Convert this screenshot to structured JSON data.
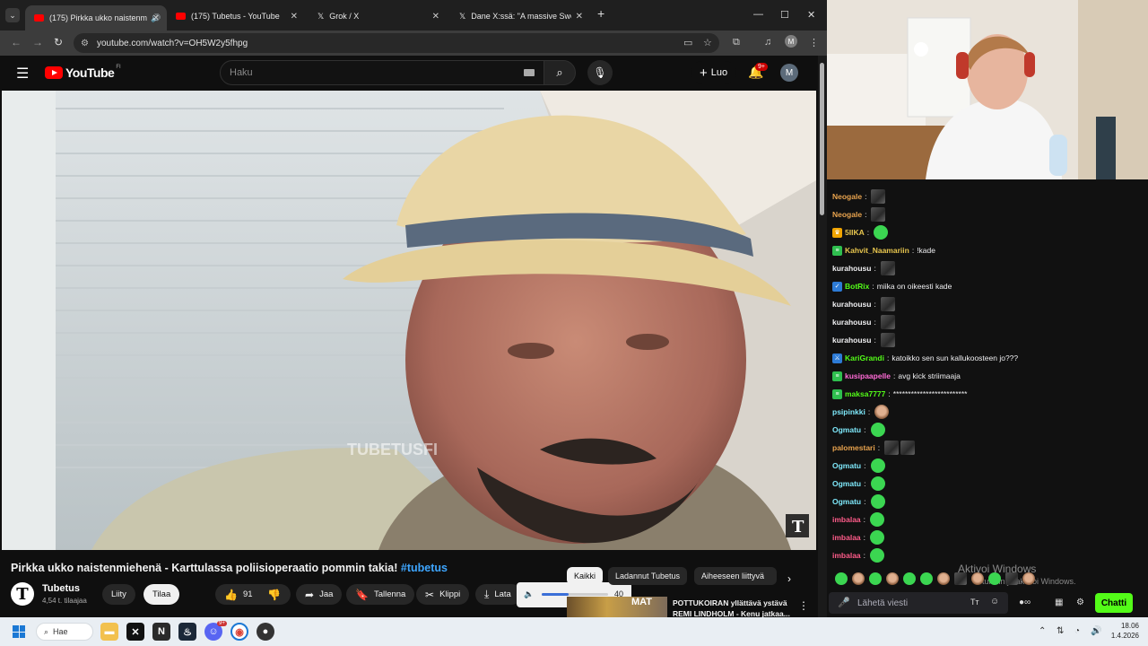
{
  "browser": {
    "tabs": [
      {
        "title": "(175) Pirkka ukko naistenm",
        "active": true
      },
      {
        "title": "(175) Tubetus - YouTube",
        "active": false
      },
      {
        "title": "Grok / X",
        "active": false
      },
      {
        "title": "Dane X:ssä: \"A massive Swedish",
        "active": false
      }
    ],
    "url": "youtube.com/watch?v=OH5W2y5fhpg",
    "profile_initial": "M"
  },
  "youtube": {
    "logo_text": "YouTube",
    "country_code": "FI",
    "search_placeholder": "Haku",
    "create_label": "Luo",
    "notification_count": "9+",
    "avatar_initial": "M",
    "video": {
      "watermark": "TUBETUSFI",
      "corner_logo": "T"
    },
    "title": "Pirkka ukko naistenmiehenä - Karttulassa poliisioperaatio pommin takia!",
    "title_tag": "#tubetus",
    "channel": {
      "name": "Tubetus",
      "subscribers": "4,54 t. tilaajaa",
      "avatar_letter": "T"
    },
    "join_label": "Liity",
    "subscribe_label": "Tilaa",
    "like_count": "91",
    "share_label": "Jaa",
    "save_label": "Tallenna",
    "clip_label": "Klippi",
    "download_label": "Lata",
    "volume": 40,
    "volume_label": "40",
    "chips": [
      "Kaikki",
      "Ladannut Tubetus",
      "Aiheeseen liittyvä"
    ],
    "recommended": {
      "title_line1": "POTTUKOIRAN yllättävä ystävä",
      "title_line2": "REMI LINDHOLM - Kenu jatkaa...",
      "thumb_text": "MAT"
    }
  },
  "chat": {
    "messages": [
      {
        "user": "Neogale",
        "color": "#e8a34e",
        "text": "",
        "emotes": [
          "gray"
        ],
        "badge": ""
      },
      {
        "user": "Neogale",
        "color": "#e8a34e",
        "text": "",
        "emotes": [
          "gray"
        ],
        "badge": ""
      },
      {
        "user": "5IIKA",
        "color": "#e8c64e",
        "text": "",
        "emotes": [
          "green"
        ],
        "badge": "crown"
      },
      {
        "user": "Kahvit_Naamariin",
        "color": "#e8c64e",
        "text": "!kade",
        "emotes": [],
        "badge": "sub"
      },
      {
        "user": "kurahousu",
        "color": "#efeff1",
        "text": "",
        "emotes": [
          "gray"
        ],
        "badge": ""
      },
      {
        "user": "BotRix",
        "color": "#53fc18",
        "text": "miika on oikeesti kade",
        "emotes": [],
        "badge": "bot"
      },
      {
        "user": "kurahousu",
        "color": "#efeff1",
        "text": "",
        "emotes": [
          "gray"
        ],
        "badge": ""
      },
      {
        "user": "kurahousu",
        "color": "#efeff1",
        "text": "",
        "emotes": [
          "gray"
        ],
        "badge": ""
      },
      {
        "user": "kurahousu",
        "color": "#efeff1",
        "text": "",
        "emotes": [
          "gray"
        ],
        "badge": ""
      },
      {
        "user": "KariGrandi",
        "color": "#53fc18",
        "text": "katoikko sen sun kallukoosteen jo???",
        "emotes": [],
        "badge": "mod"
      },
      {
        "user": "kusipaapelle",
        "color": "#ff6bd6",
        "text": "avg kick striimaaja",
        "emotes": [],
        "badge": "sub"
      },
      {
        "user": "maksa7777",
        "color": "#53fc18",
        "text": "*************************",
        "emotes": [],
        "badge": "sub"
      },
      {
        "user": "psipinkki",
        "color": "#7ee8fa",
        "text": "",
        "emotes": [
          "face"
        ],
        "badge": ""
      },
      {
        "user": "Ogmatu",
        "color": "#7ee8fa",
        "text": "",
        "emotes": [
          "green"
        ],
        "badge": ""
      },
      {
        "user": "palomestari",
        "color": "#e8a34e",
        "text": "",
        "emotes": [
          "gray",
          "gray"
        ],
        "badge": ""
      },
      {
        "user": "Ogmatu",
        "color": "#7ee8fa",
        "text": "",
        "emotes": [
          "green"
        ],
        "badge": ""
      },
      {
        "user": "Ogmatu",
        "color": "#7ee8fa",
        "text": "",
        "emotes": [
          "green"
        ],
        "badge": ""
      },
      {
        "user": "Ogmatu",
        "color": "#7ee8fa",
        "text": "",
        "emotes": [
          "green"
        ],
        "badge": ""
      },
      {
        "user": "imbalaa",
        "color": "#ff5c8a",
        "text": "",
        "emotes": [
          "green"
        ],
        "badge": ""
      },
      {
        "user": "imbalaa",
        "color": "#ff5c8a",
        "text": "",
        "emotes": [
          "green"
        ],
        "badge": ""
      },
      {
        "user": "imbalaa",
        "color": "#ff5c8a",
        "text": "",
        "emotes": [
          "green"
        ],
        "badge": ""
      }
    ],
    "watermark_line1": "Aktivoi Windows",
    "watermark_line2": "tuksiin ja aktivoi Windows.",
    "input_placeholder": "Lähetä viesti",
    "send_label": "Chatti",
    "accent": "#53fc18"
  },
  "taskbar": {
    "search_label": "Hae",
    "notification_badge": "9+",
    "time": "18.06",
    "date": "1.4.2026"
  }
}
